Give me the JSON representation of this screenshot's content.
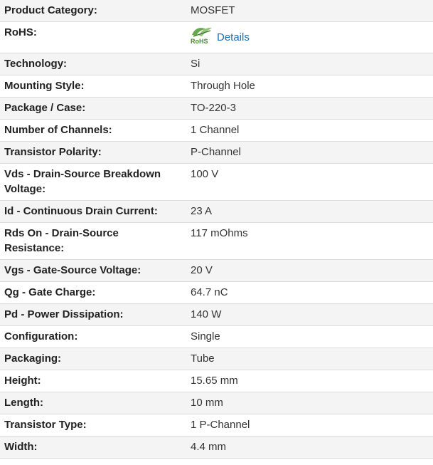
{
  "specs": [
    {
      "label": "Product Category:",
      "value": "MOSFET"
    },
    {
      "label": "RoHS:",
      "value": "",
      "rohs": {
        "logo_text": "RoHS",
        "link": "Details"
      }
    },
    {
      "label": "Technology:",
      "value": "Si"
    },
    {
      "label": "Mounting Style:",
      "value": "Through Hole"
    },
    {
      "label": "Package / Case:",
      "value": "TO-220-3"
    },
    {
      "label": "Number of Channels:",
      "value": "1 Channel"
    },
    {
      "label": "Transistor Polarity:",
      "value": "P-Channel"
    },
    {
      "label": "Vds - Drain-Source Breakdown Voltage:",
      "value": "100 V"
    },
    {
      "label": "Id - Continuous Drain Current:",
      "value": "23 A"
    },
    {
      "label": "Rds On - Drain-Source Resistance:",
      "value": "117 mOhms"
    },
    {
      "label": "Vgs - Gate-Source Voltage:",
      "value": "20 V"
    },
    {
      "label": "Qg - Gate Charge:",
      "value": "64.7 nC"
    },
    {
      "label": "Pd - Power Dissipation:",
      "value": "140 W"
    },
    {
      "label": "Configuration:",
      "value": "Single"
    },
    {
      "label": "Packaging:",
      "value": "Tube"
    },
    {
      "label": "Height:",
      "value": "15.65 mm"
    },
    {
      "label": "Length:",
      "value": "10 mm"
    },
    {
      "label": "Transistor Type:",
      "value": "1 P-Channel"
    },
    {
      "label": "Width:",
      "value": "4.4 mm"
    }
  ],
  "colors": {
    "link": "#1a6fb5",
    "rohs_green": "#4a8a2a"
  },
  "icons": {
    "rohs": "rohs-leaf-icon"
  }
}
